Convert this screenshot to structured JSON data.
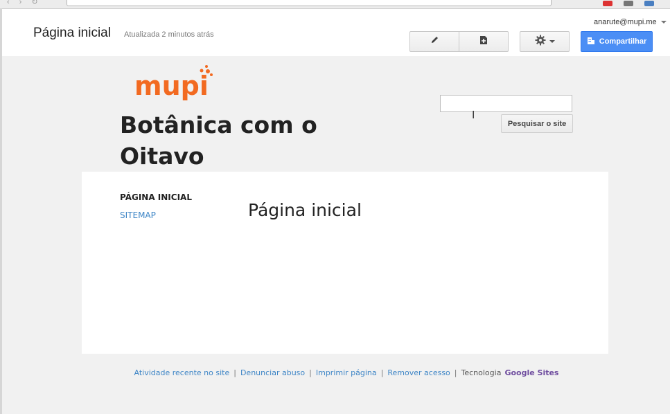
{
  "header": {
    "page_title": "Página inicial",
    "updated": "Atualizada 2 minutos atrás",
    "user_email": "anarute@mupi.me",
    "share_label": "Compartilhar"
  },
  "site": {
    "logo_text": "mupi",
    "name": "Botânica com o Oitavo",
    "search_button": "Pesquisar o site"
  },
  "nav": {
    "current": "PÁGINA INICIAL",
    "sitemap": "SITEMAP"
  },
  "content": {
    "heading": "Página inicial"
  },
  "footer": {
    "recent_activity": "Atividade recente no site",
    "report_abuse": "Denunciar abuso",
    "print_page": "Imprimir página",
    "remove_access": "Remover acesso",
    "powered_by": "Tecnologia",
    "google_sites": "Google Sites"
  },
  "colors": {
    "share_blue": "#4b8ef5",
    "link_blue": "#3d85c6",
    "logo_orange": "#f26a21",
    "google_sites_purple": "#6f4d9f"
  },
  "icons": [
    "pencil-icon",
    "new-page-icon",
    "gear-icon",
    "share-building-icon"
  ]
}
